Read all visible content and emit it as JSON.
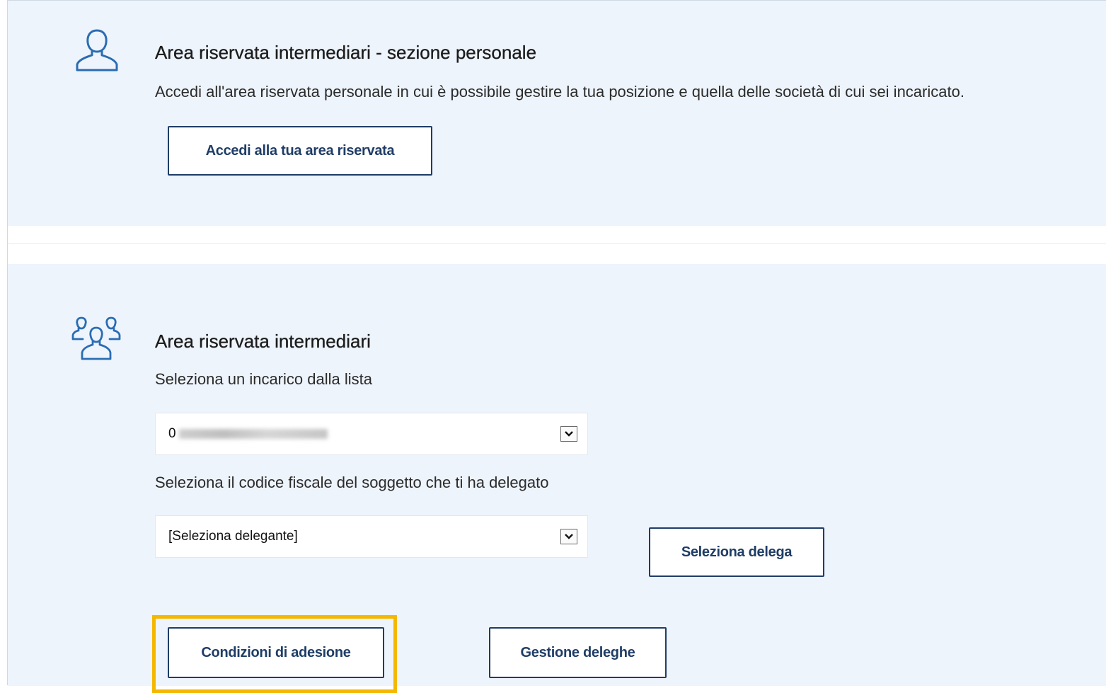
{
  "personal": {
    "icon": "user-icon",
    "title": "Area riservata intermediari - sezione personale",
    "description": "Accedi all'area riservata personale in cui è possibile gestire la tua posizione e quella delle società di cui sei incaricato.",
    "access_button": "Accedi alla tua area riservata"
  },
  "intermediari": {
    "icon": "users-group-icon",
    "title": "Area riservata intermediari",
    "incarico_label": "Seleziona un incarico dalla lista",
    "incarico_value_prefix": "0",
    "delegante_label": "Seleziona il codice fiscale del soggetto che ti ha delegato",
    "delegante_value": "[Seleziona delegante]",
    "select_delega_button": "Seleziona delega",
    "condizioni_button": "Condizioni di adesione",
    "gestione_button": "Gestione deleghe"
  },
  "colors": {
    "panel_bg": "#eef4fc",
    "icon": "#2a6db2",
    "button_border": "#1f3d66",
    "highlight": "#f5b800"
  }
}
